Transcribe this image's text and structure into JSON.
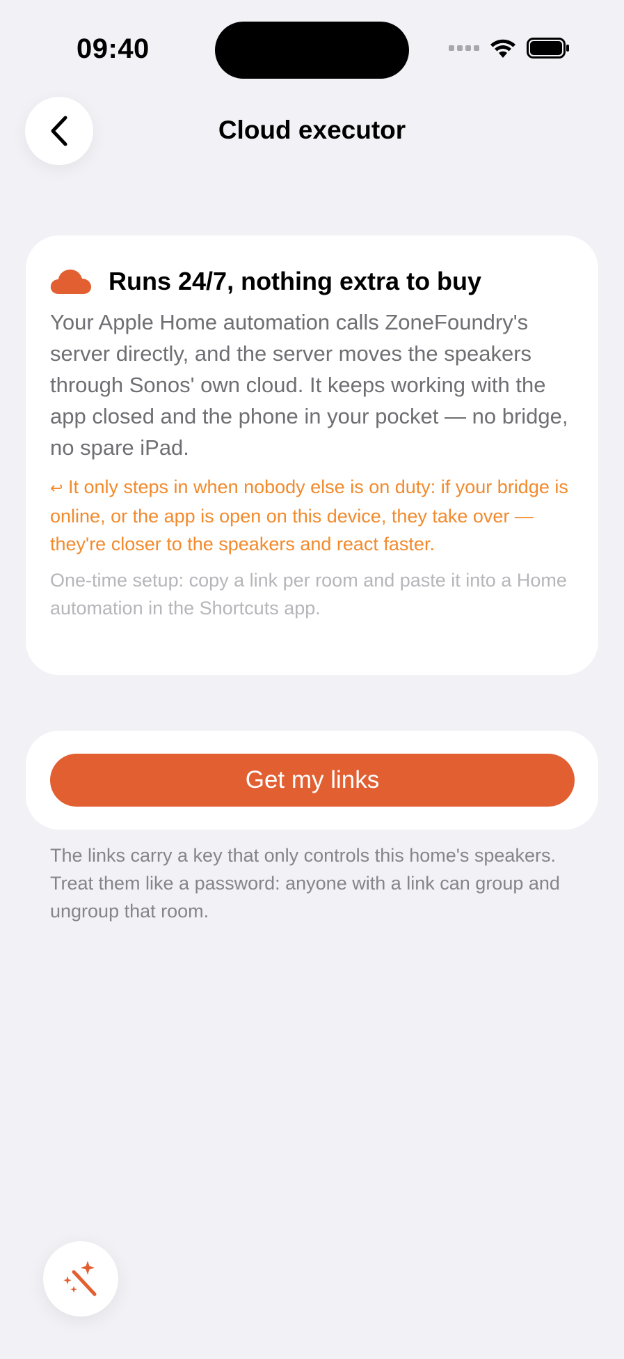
{
  "status_bar": {
    "time": "09:40"
  },
  "nav": {
    "title": "Cloud executor"
  },
  "info_card": {
    "icon": "cloud-icon",
    "title": "Runs 24/7, nothing extra to buy",
    "body": "Your Apple Home automation calls ZoneFoundry's server directly, and the server moves the speakers through Sonos' own cloud. It keeps working with the app closed and the phone in your pocket — no bridge, no spare iPad.",
    "note_glyph": "↩",
    "note": "It only steps in when nobody else is on duty: if your bridge is online, or the app is open on this device, they take over — they're closer to the speakers and react faster.",
    "footnote": "One-time setup: copy a link per room and paste it into a Home automation in the Shortcuts app."
  },
  "links": {
    "button_label": "Get my links",
    "caption": "The links carry a key that only controls this home's speakers. Treat them like a password: anyone with a link can group and ungroup that room."
  },
  "fab": {
    "icon": "magic-wand-icon"
  },
  "colors": {
    "accent": "#e15f31",
    "note": "#f28a2c",
    "background": "#f1f1f6"
  }
}
